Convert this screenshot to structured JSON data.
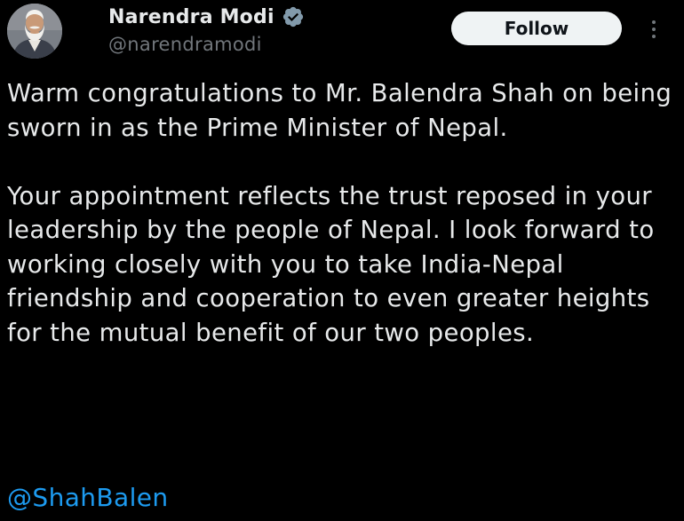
{
  "author": {
    "display_name": "Narendra Modi",
    "handle": "@narendramodi",
    "verified_icon": "verified-badge-icon",
    "avatar_icon": "profile-photo"
  },
  "actions": {
    "follow_label": "Follow",
    "more_icon": "more-options-icon"
  },
  "tweet": {
    "paragraph_1": "Warm congratulations to Mr. Balendra Shah on being sworn in as the Prime Minister of Nepal.",
    "paragraph_2": "Your appointment reflects the trust reposed in your leadership by the people of Nepal. I look forward to working closely with you to take India-Nepal friendship and cooperation to even greater heights for the mutual benefit of our two peoples.",
    "mention": "@ShahBalen"
  },
  "colors": {
    "background": "#000000",
    "text": "#e7e9ea",
    "secondary_text": "#71767b",
    "link": "#1d9bf0",
    "verified": "#829aab",
    "follow_button_bg": "#eff3f4"
  }
}
